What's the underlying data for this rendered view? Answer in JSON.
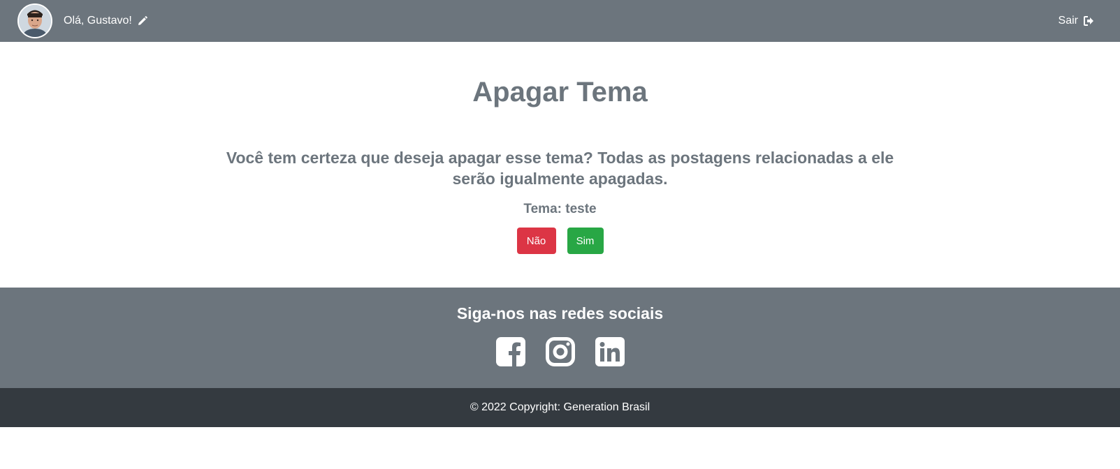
{
  "navbar": {
    "greeting": "Olá, Gustavo!",
    "logout_label": "Sair",
    "avatar_alt": "Foto de perfil",
    "icons": {
      "edit": "pencil-icon",
      "logout": "sign-out-icon"
    }
  },
  "main": {
    "title": "Apagar Tema",
    "confirm_text": "Você tem certeza que deseja apagar esse tema? Todas as postagens relacionadas a ele serão igualmente apagadas.",
    "theme_line": "Tema: teste",
    "no_label": "Não",
    "yes_label": "Sim"
  },
  "footer": {
    "social_title": "Siga-nos nas redes sociais",
    "social_icons": [
      "facebook-icon",
      "instagram-icon",
      "linkedin-icon"
    ],
    "copyright": "© 2022 Copyright: Generation Brasil"
  },
  "colors": {
    "navbar": "#6c757d",
    "footer_dark": "#343a40",
    "danger": "#dc3545",
    "success": "#28a745",
    "text_muted": "#6c757d"
  }
}
